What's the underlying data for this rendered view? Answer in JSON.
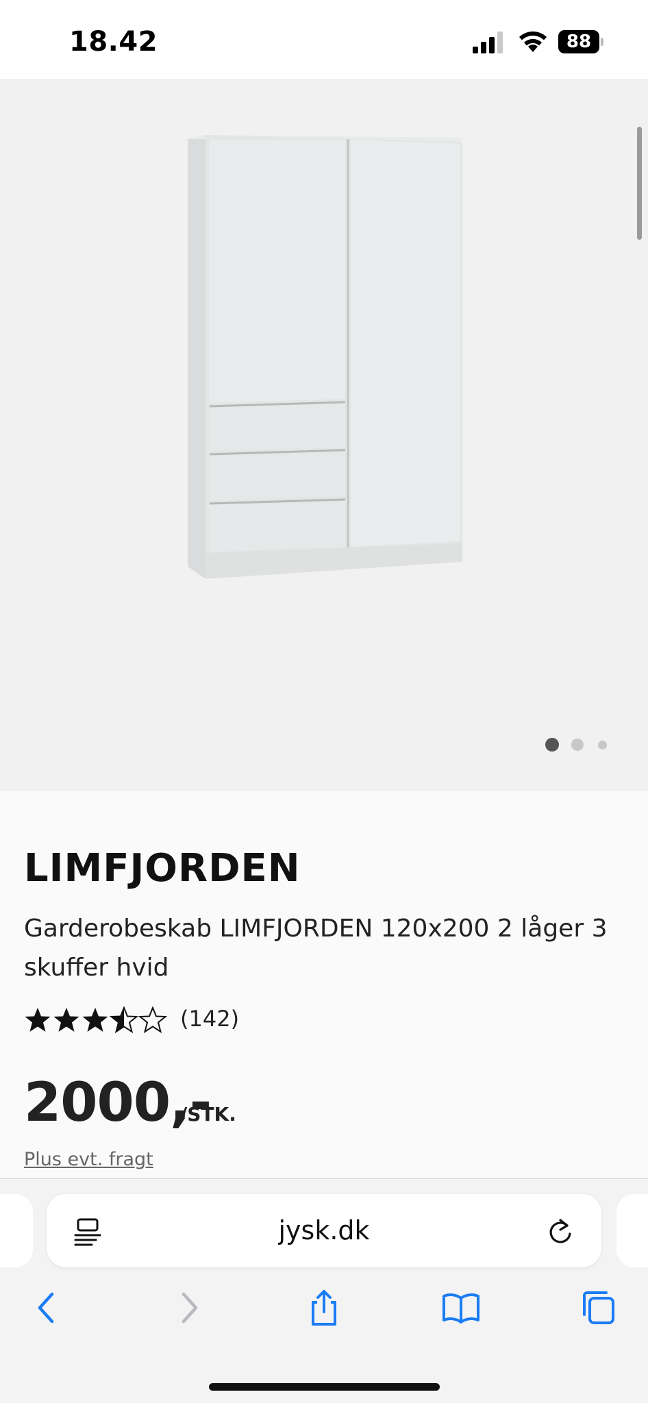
{
  "status_bar": {
    "time": "18.42",
    "battery_percent": "88"
  },
  "gallery": {
    "image_alt": "Garderobeskab LIMFJORDEN hvid",
    "active_dot": 0,
    "dot_count": 3
  },
  "product": {
    "brand": "LIMFJORDEN",
    "title": "Garderobeskab LIMFJORDEN 120x200 2 låger 3 skuffer hvid",
    "rating_value": 3.5,
    "rating_max": 5,
    "rating_count": "(142)",
    "price": "2000,-",
    "price_unit": "/STK.",
    "shipping_note": "Plus evt. fragt"
  },
  "browser": {
    "url": "jysk.dk"
  },
  "colors": {
    "accent": "#1a7cf5",
    "disabled": "#b8b8bd",
    "gallery_bg": "#f1f1f1",
    "dot_active": "#555555",
    "dot_inactive": "#c8c8c8"
  }
}
